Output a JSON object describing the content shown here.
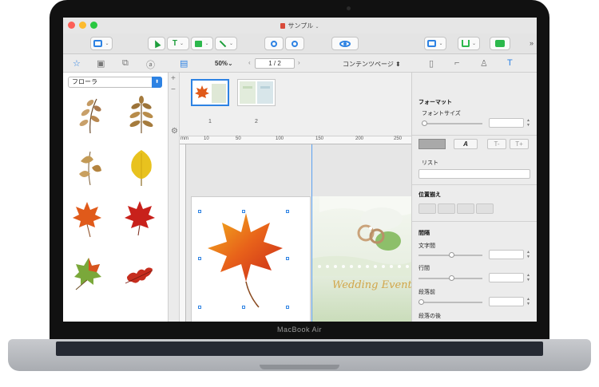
{
  "window": {
    "title": "サンプル"
  },
  "device": {
    "brand": "MacBook Air"
  },
  "toolbar": {
    "chevron": "⌄",
    "more": "»"
  },
  "subbar": {
    "zoom": "50%⌄",
    "page_indicator": "1 / 2",
    "view_mode": "コンテンツページ ⬍"
  },
  "library": {
    "category": "フローラ"
  },
  "thumbnails": {
    "pages": [
      "1",
      "2"
    ]
  },
  "ruler": {
    "unit": "mm",
    "ticks": [
      "10",
      "50",
      "100",
      "150",
      "200",
      "250"
    ]
  },
  "canvas": {
    "page2_text": "Wedding Events"
  },
  "inspector": {
    "format_heading": "フォーマット",
    "font_size_label": "フォントサイズ",
    "style_a": "A",
    "style_t1": "T-",
    "style_t2": "T+",
    "list_label": "リスト",
    "align_heading": "位置揃え",
    "spacing_heading": "間隔",
    "char_spacing": "文字間",
    "line_spacing": "行間",
    "before_para": "段落前",
    "after_para": "段落の後"
  }
}
